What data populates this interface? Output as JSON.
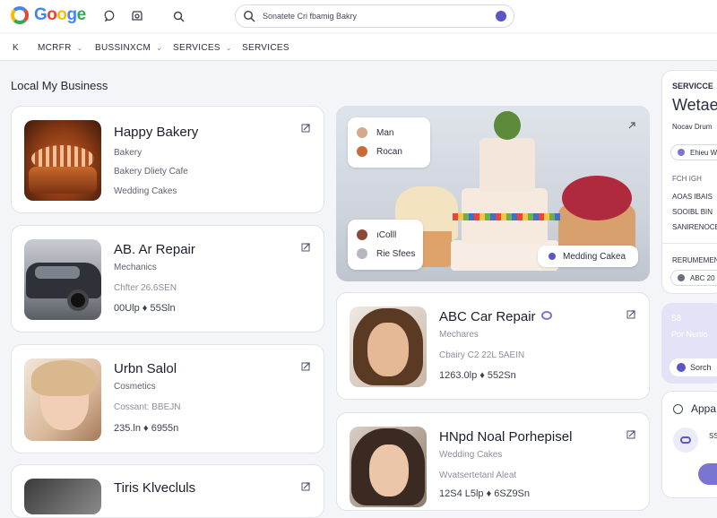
{
  "header": {
    "logo_text": "Googe",
    "search_placeholder": "Sonatete Cri fbamig Bakry"
  },
  "nav": {
    "back_icon": "K",
    "items": [
      "MCRFR",
      "BUSSINXCM",
      "SERVICES",
      "SERVICES"
    ]
  },
  "section_title": "Local My Business",
  "cards": [
    {
      "title": "Happy Bakery",
      "line1": "Bakery",
      "line2": "Bakery Dliety Cafe",
      "line3": "Wedding Cakes"
    },
    {
      "title": "AB. Ar Repair",
      "line1": "Mechanics",
      "line2": "Chfter   26.6SEN",
      "line3": "00Ulp   ♦ 55Sln"
    },
    {
      "title": "Urbn Salol",
      "line1": "Cosmetics",
      "line2": "Cossant: BBEJN",
      "line3": "235.ln   ♦ 6955n"
    },
    {
      "title": "Tiris Klvecluls"
    },
    {
      "title": "ABC Car Repair",
      "line1": "Mechares",
      "line2": "Cbairy  C2 22L 5AEIN",
      "line3": "1263.0lp   ♦ 552Sn"
    },
    {
      "title": "HNpd Noal Porhepisel",
      "line1": "Wedding Cakes",
      "line2": "Wvatsertetanl Aleat",
      "line3": "12S4 L5lp   ♦ 6SZ9Sn"
    }
  ],
  "hero": {
    "top_items": [
      "Man",
      "Rocan"
    ],
    "bottom_items": [
      "ıColll",
      "Rie Sfees"
    ],
    "tag": "Medding Cakea"
  },
  "right_panel": {
    "label": "SERVICCE",
    "title": "Wetae",
    "subtitle": "Nocav Drum",
    "chip": "Ehieu W",
    "sub_heading": "FCH IGH",
    "rows": [
      "AOAS IBAIS",
      "SOOIBL BIN",
      "SANIRENOCE"
    ],
    "heading2": "RERUMEMEN",
    "item2": "ABC 20"
  },
  "right_purple": {
    "line1": "S8",
    "line2": "Por Nertlo",
    "button": "Sorch"
  },
  "right_bottom": {
    "label": "Appa",
    "small": "SS"
  },
  "colors": {
    "accent": "#5b56c4",
    "purple_bg": "#e4e2f6",
    "page_bg": "#f4f5f8"
  }
}
